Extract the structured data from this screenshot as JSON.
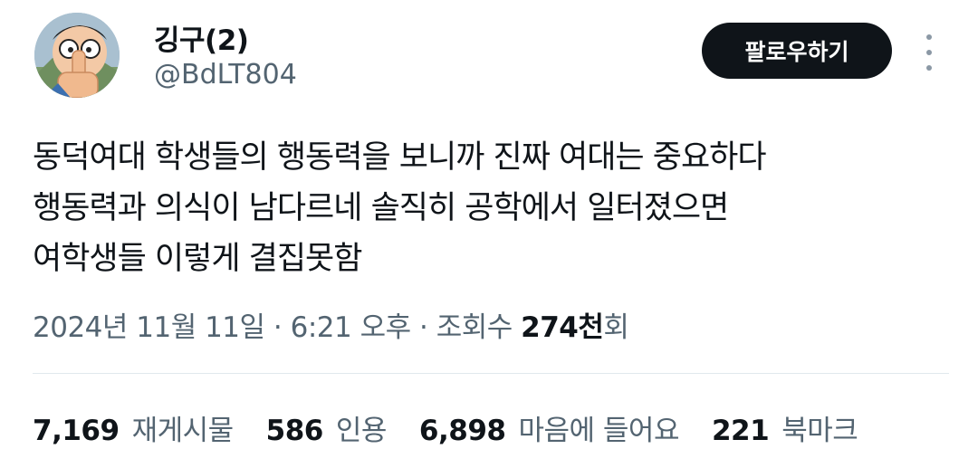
{
  "author": {
    "display_name": "깅구(2)",
    "handle": "@BdLT804"
  },
  "follow_button": "팔로우하기",
  "tweet": {
    "lines": [
      "동덕여대 학생들의 행동력을 보니까 진짜 여대는 중요하다",
      "행동력과 의식이 남다르네 솔직히 공학에서 일터졌으면",
      "여학생들 이렇게 결집못함"
    ]
  },
  "meta": {
    "date": "2024년 11월 11일",
    "separator": "·",
    "time": "6:21 오후",
    "views_label": "조회수",
    "views_count": "274천",
    "views_suffix": "회"
  },
  "stats": [
    {
      "count": "7,169",
      "label": "재게시물"
    },
    {
      "count": "586",
      "label": "인용"
    },
    {
      "count": "6,898",
      "label": "마음에 들어요"
    },
    {
      "count": "221",
      "label": "북마크"
    }
  ],
  "icons": {
    "more": "more-vertical-icon"
  },
  "colors": {
    "text_primary": "#0f1419",
    "text_secondary": "#536471",
    "button_bg": "#0f1419",
    "button_text": "#ffffff",
    "divider": "#e1e8ed"
  }
}
